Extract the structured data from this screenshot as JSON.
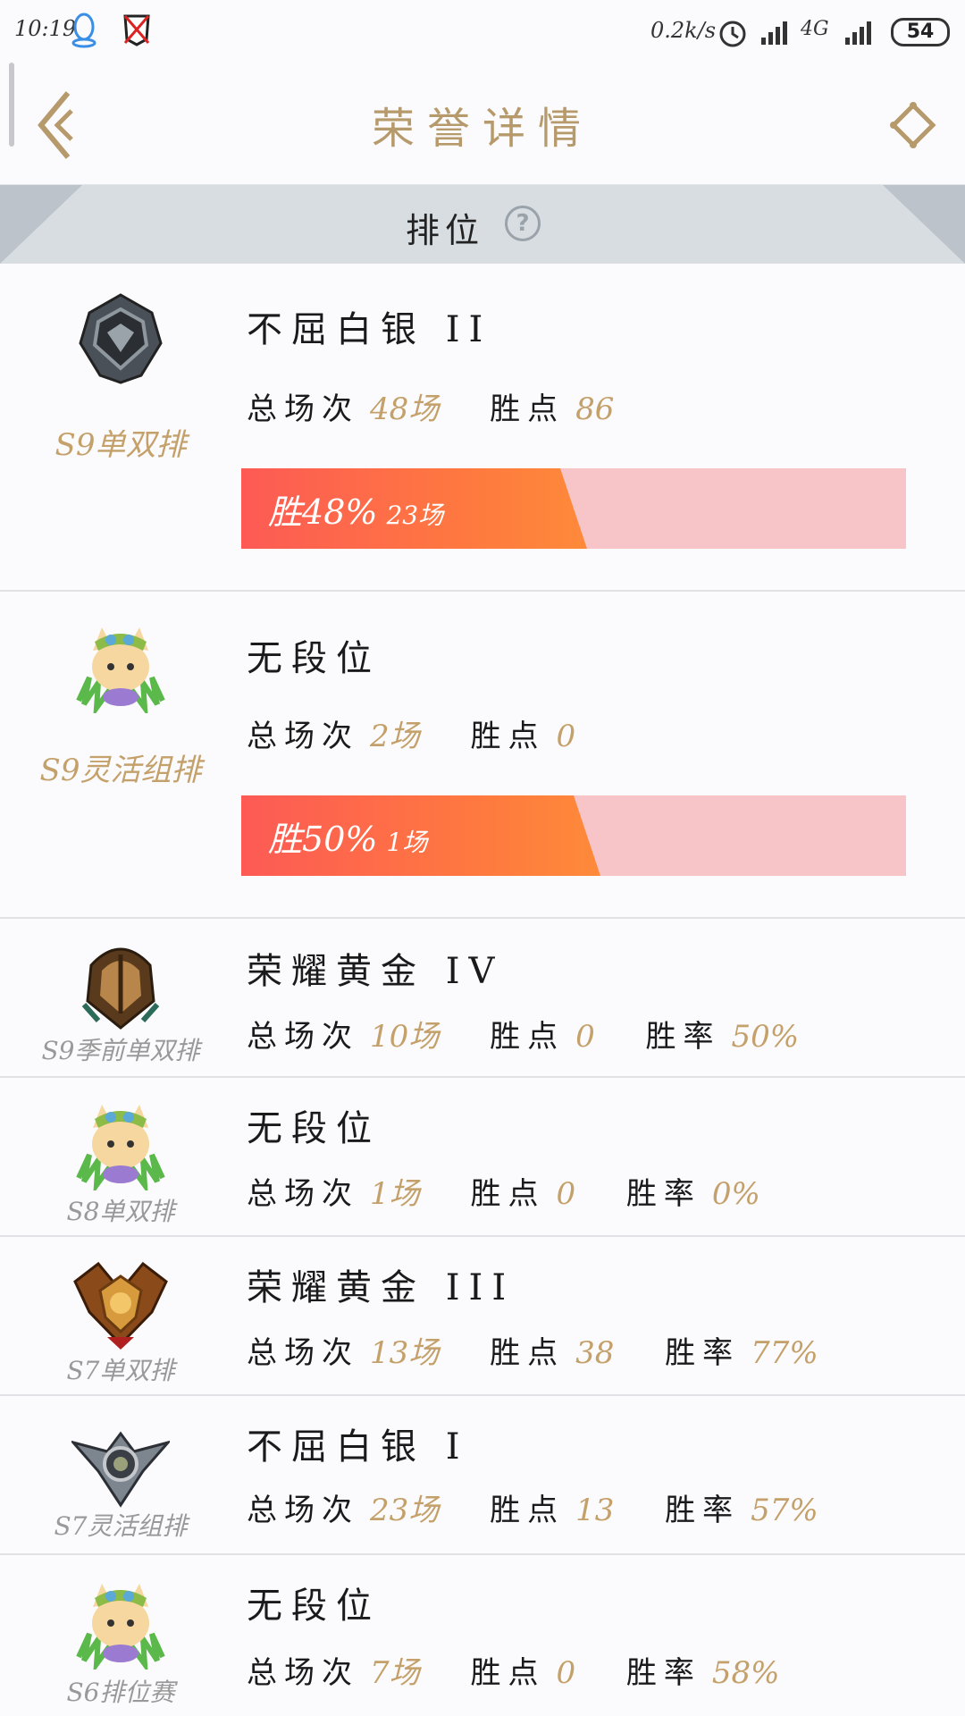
{
  "status_bar": {
    "time": "10:19",
    "speed": "0.2k/s",
    "network": "4G",
    "battery": "54"
  },
  "nav": {
    "title": "荣誉详情"
  },
  "section": {
    "label": "排位",
    "help": "?"
  },
  "labels": {
    "total": "总场次",
    "points": "胜点",
    "rate": "胜率",
    "win": "胜"
  },
  "colors": {
    "accent": "#c4a06a",
    "title": "#b79a6c",
    "win_bar": "#fd5a55",
    "loss_bar": "#f7c4c8"
  },
  "records": [
    {
      "queue": "S9单双排",
      "rank": "不屈白银 II",
      "icon": "silver-rank-emblem-icon",
      "total": "48场",
      "points": "86",
      "win_rate": 0.48,
      "win_rate_text": "48%",
      "wins": "23场"
    },
    {
      "queue": "S9灵活组排",
      "rank": "无段位",
      "icon": "teemo-unranked-icon",
      "total": "2场",
      "points": "0",
      "win_rate": 0.5,
      "win_rate_text": "50%",
      "wins": "1场"
    },
    {
      "queue": "S9季前单双排",
      "rank": "荣耀黄金 IV",
      "icon": "gold-rank-helmet-icon",
      "total": "10场",
      "points": "0",
      "rate": "50%"
    },
    {
      "queue": "S8单双排",
      "rank": "无段位",
      "icon": "teemo-unranked-icon",
      "total": "1场",
      "points": "0",
      "rate": "0%"
    },
    {
      "queue": "S7单双排",
      "rank": "荣耀黄金 III",
      "icon": "gold-rank-emblem-icon",
      "total": "13场",
      "points": "38",
      "rate": "77%"
    },
    {
      "queue": "S7灵活组排",
      "rank": "不屈白银 I",
      "icon": "silver-rank-wing-icon",
      "total": "23场",
      "points": "13",
      "rate": "57%"
    },
    {
      "queue": "S6排位赛",
      "rank": "无段位",
      "icon": "teemo-unranked-icon",
      "total": "7场",
      "points": "0",
      "rate": "58%"
    }
  ]
}
